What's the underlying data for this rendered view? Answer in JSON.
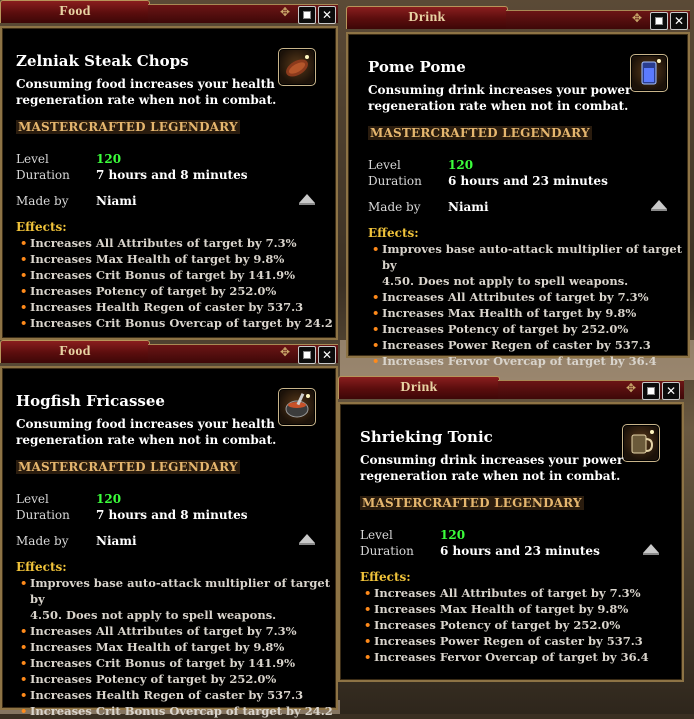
{
  "windows": [
    {
      "tab": "Food",
      "name": "Zelniak Steak Chops",
      "description": [
        "Consuming food increases your health",
        "regeneration rate when not in combat."
      ],
      "tier": "MASTERCRAFTED LEGENDARY",
      "level_label": "Level",
      "level": "120",
      "duration_label": "Duration",
      "duration": "7 hours and 8 minutes",
      "made_by_label": "Made by",
      "made_by": "Niami",
      "effects_label": "Effects:",
      "effects": [
        "Increases All Attributes of target by 7.3%",
        "Increases Max Health of target by 9.8%",
        "Increases Crit Bonus of target by 141.9%",
        "Increases Potency of target by 252.0%",
        "Increases Health Regen of caster by 537.3",
        "Increases Crit Bonus Overcap of target by 24.2"
      ],
      "icon": "steak-icon"
    },
    {
      "tab": "Drink",
      "name": "Pome Pome",
      "description": [
        "Consuming drink increases your power",
        "regeneration rate when not in combat."
      ],
      "tier": "MASTERCRAFTED LEGENDARY",
      "level_label": "Level",
      "level": "120",
      "duration_label": "Duration",
      "duration": "6 hours and 23 minutes",
      "made_by_label": "Made by",
      "made_by": "Niami",
      "effects_label": "Effects:",
      "effects": [
        "Improves base auto-attack multiplier of target by",
        "4.50. Does not apply to spell weapons.",
        "Increases All Attributes of target by 7.3%",
        "Increases Max Health of target by 9.8%",
        "Increases Potency of target by 252.0%",
        "Increases Power Regen of caster by 537.3",
        "Increases Fervor Overcap of target by 36.4"
      ],
      "icon": "glass-drink-icon"
    },
    {
      "tab": "Food",
      "name": "Hogfish Fricassee",
      "description": [
        "Consuming food increases your health",
        "regeneration rate when not in combat."
      ],
      "tier": "MASTERCRAFTED LEGENDARY",
      "level_label": "Level",
      "level": "120",
      "duration_label": "Duration",
      "duration": "7 hours and 8 minutes",
      "made_by_label": "Made by",
      "made_by": "Niami",
      "effects_label": "Effects:",
      "effects": [
        "Improves base auto-attack multiplier of target by",
        "4.50. Does not apply to spell weapons.",
        "Increases All Attributes of target by 7.3%",
        "Increases Max Health of target by 9.8%",
        "Increases Crit Bonus of target by 141.9%",
        "Increases Potency of target by 252.0%",
        "Increases Health Regen of caster by 537.3",
        "Increases Crit Bonus Overcap of target by 24.2"
      ],
      "icon": "stew-pot-icon"
    },
    {
      "tab": "Drink",
      "name": "Shrieking Tonic",
      "description": [
        "Consuming drink increases your power",
        "regeneration rate when not in combat."
      ],
      "tier": "MASTERCRAFTED LEGENDARY",
      "level_label": "Level",
      "level": "120",
      "duration_label": "Duration",
      "duration": "6 hours and 23 minutes",
      "effects_label": "Effects:",
      "effects": [
        "Increases All Attributes of target by 7.3%",
        "Increases Max Health of target by 9.8%",
        "Increases Potency of target by 252.0%",
        "Increases Power Regen of caster by 537.3",
        "Increases Fervor Overcap of target by 36.4"
      ],
      "icon": "mug-icon"
    }
  ],
  "controls": {
    "restore": "□",
    "close": "✕"
  }
}
